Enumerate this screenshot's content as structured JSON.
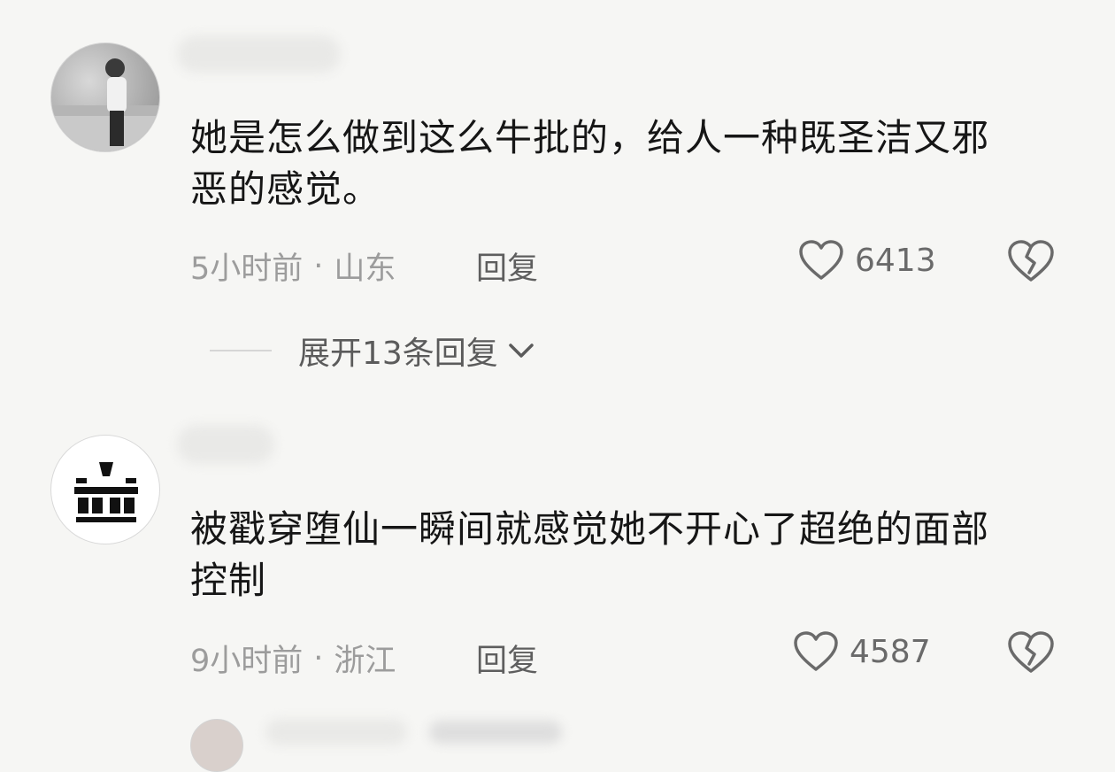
{
  "comments": [
    {
      "username": "",
      "text_line1": "她是怎么做到这么牛批的，给人一种既圣洁又邪",
      "text_line2": "恶的感觉。",
      "time": "5小时前",
      "location": "山东",
      "separator": "·",
      "reply_label": "回复",
      "likes": "6413"
    },
    {
      "username": "",
      "text_line1": "被戳穿堕仙一瞬间就感觉她不开心了超绝的面部",
      "text_line2": "控制",
      "time": "9小时前",
      "location": "浙江",
      "separator": "·",
      "reply_label": "回复",
      "likes": "4587"
    }
  ],
  "expand_replies": "展开13条回复",
  "icons": {
    "like": "heart-outline-icon",
    "dislike": "broken-heart-icon",
    "expand": "chevron-down-icon"
  },
  "colors": {
    "background": "#f6f6f4",
    "text": "#161616",
    "meta": "#9c9c9c",
    "icon": "#6a6a6a"
  }
}
